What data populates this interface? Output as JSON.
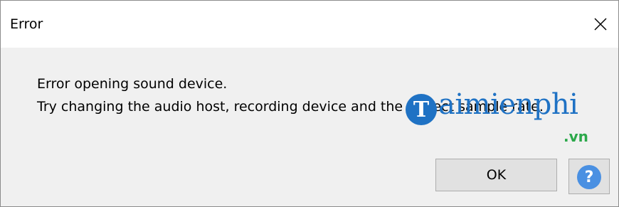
{
  "window": {
    "title": "Error"
  },
  "message": {
    "line1": "Error opening sound device.",
    "line2": "Try changing the audio host, recording device and the project sample rate."
  },
  "buttons": {
    "ok_label": "OK",
    "help_label": "?"
  },
  "watermark": {
    "initial": "T",
    "text": "aimienphi",
    "suffix": ".vn"
  },
  "colors": {
    "dialog_bg": "#f0f0f0",
    "titlebar_bg": "#ffffff",
    "button_bg": "#e1e1e1",
    "help_accent": "#4a90e2",
    "watermark_blue": "#1f72c4",
    "watermark_green": "#2ba84a"
  },
  "icons": {
    "close": "close-icon",
    "help": "help-icon"
  }
}
